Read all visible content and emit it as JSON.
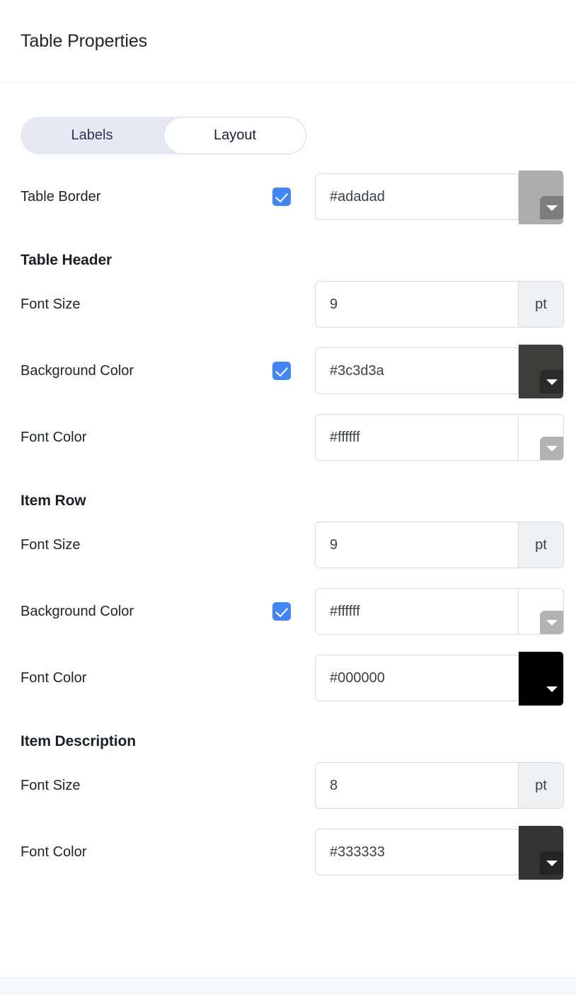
{
  "header": {
    "title": "Table Properties"
  },
  "tabs": {
    "items": [
      {
        "label": "Labels",
        "active": false
      },
      {
        "label": "Layout",
        "active": true
      }
    ]
  },
  "units": {
    "pt": "pt"
  },
  "sections": [
    {
      "heading": "",
      "rows": [
        {
          "label": "Table Border",
          "type": "color",
          "checkbox": true,
          "checked": true,
          "value": "#adadad",
          "swatch_color": "#adadad",
          "arrow_button_color": "#7d7d7d"
        }
      ]
    },
    {
      "heading": "Table Header",
      "rows": [
        {
          "label": "Font Size",
          "type": "number",
          "checkbox": false,
          "value": "9",
          "unit": "pt"
        },
        {
          "label": "Background Color",
          "type": "color",
          "checkbox": true,
          "checked": true,
          "value": "#3c3d3a",
          "swatch_color": "#3c3d3a",
          "arrow_button_color": "#2b2c29"
        },
        {
          "label": "Font Color",
          "type": "color",
          "checkbox": false,
          "value": "#ffffff",
          "swatch_color": "#ffffff",
          "arrow_button_color": "#b3b3b3"
        }
      ]
    },
    {
      "heading": "Item Row",
      "rows": [
        {
          "label": "Font Size",
          "type": "number",
          "checkbox": false,
          "value": "9",
          "unit": "pt"
        },
        {
          "label": "Background Color",
          "type": "color",
          "checkbox": true,
          "checked": true,
          "value": "#ffffff",
          "swatch_color": "#ffffff",
          "arrow_button_color": "#b3b3b3"
        },
        {
          "label": "Font Color",
          "type": "color",
          "checkbox": false,
          "value": "#000000",
          "swatch_color": "#000000",
          "arrow_button_color": "#000000"
        }
      ]
    },
    {
      "heading": "Item Description",
      "rows": [
        {
          "label": "Font Size",
          "type": "number",
          "checkbox": false,
          "value": "8",
          "unit": "pt"
        },
        {
          "label": "Font Color",
          "type": "color",
          "checkbox": false,
          "value": "#333333",
          "swatch_color": "#333333",
          "arrow_button_color": "#242424"
        }
      ]
    }
  ],
  "theme": {
    "accent": "#4285f4",
    "tab_inactive_bg": "#e7e9f2",
    "border": "#d9dbe6",
    "addon_bg": "#eef0f2",
    "text": "#212529"
  }
}
